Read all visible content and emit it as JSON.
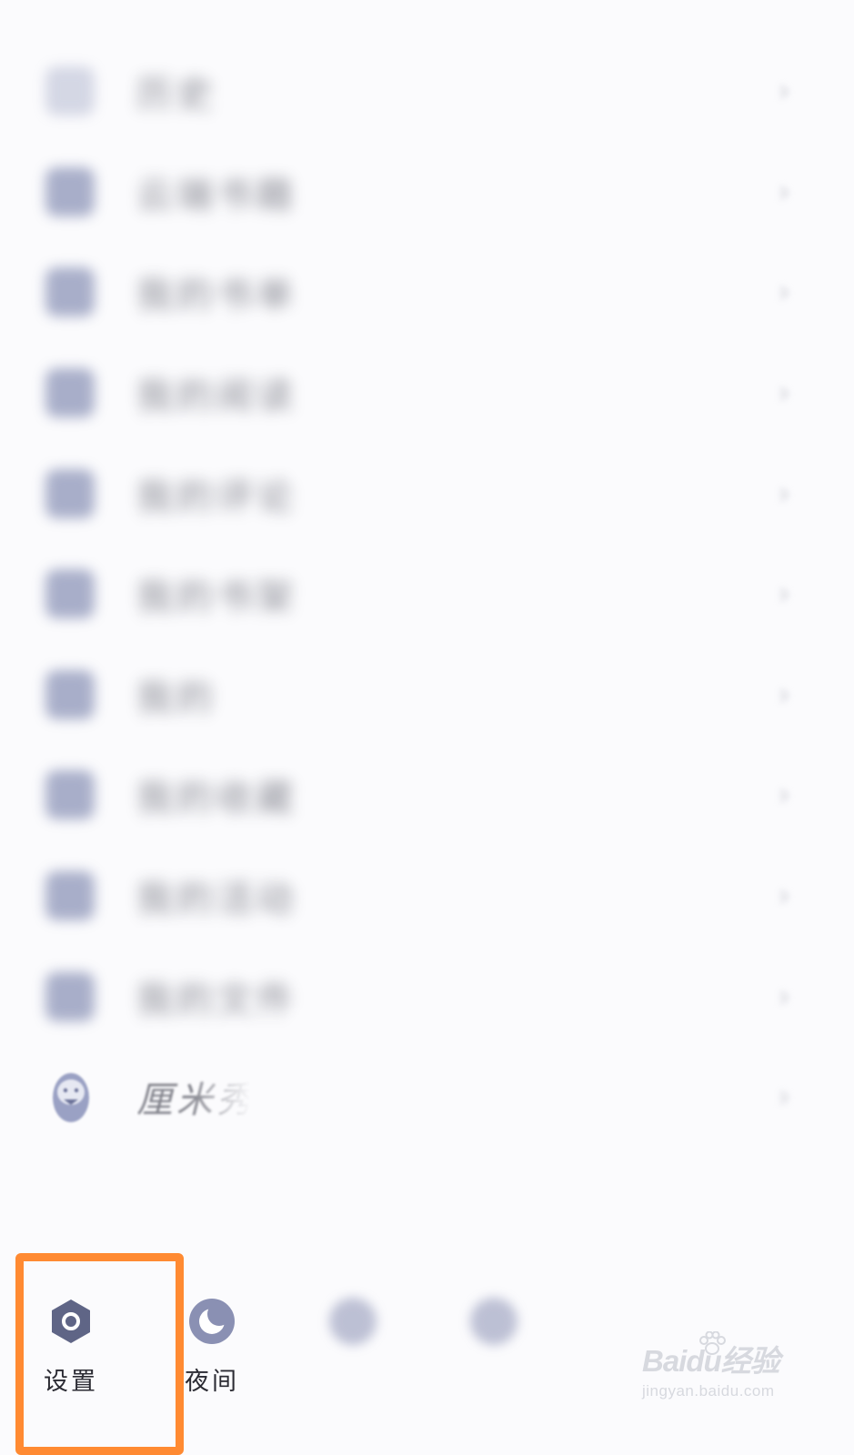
{
  "menu": {
    "items": [
      {
        "label": "历史",
        "icon": "clock-icon"
      },
      {
        "label": "云端书籍",
        "icon": "cloud-book-icon"
      },
      {
        "label": "我的书单",
        "icon": "book-list-icon"
      },
      {
        "label": "我的阅读",
        "icon": "reading-icon"
      },
      {
        "label": "我的评论",
        "icon": "comment-icon"
      },
      {
        "label": "我的书架",
        "icon": "trophy-icon"
      },
      {
        "label": "我的",
        "icon": "person-icon"
      },
      {
        "label": "我的收藏",
        "icon": "favorite-icon"
      },
      {
        "label": "我的活动",
        "icon": "activity-icon"
      },
      {
        "label": "我的文件",
        "icon": "folder-icon"
      },
      {
        "label": "厘米秀",
        "icon": "mascot-icon"
      }
    ]
  },
  "bottom_bar": {
    "settings_label": "设置",
    "night_label": "夜间",
    "tab3_label": "",
    "tab4_label": ""
  },
  "watermark": {
    "brand": "Baidu经验",
    "url": "jingyan.baidu.com"
  },
  "colors": {
    "highlight": "#ff8a32",
    "icon": "#8d95b8",
    "background": "#fbfbfd"
  }
}
